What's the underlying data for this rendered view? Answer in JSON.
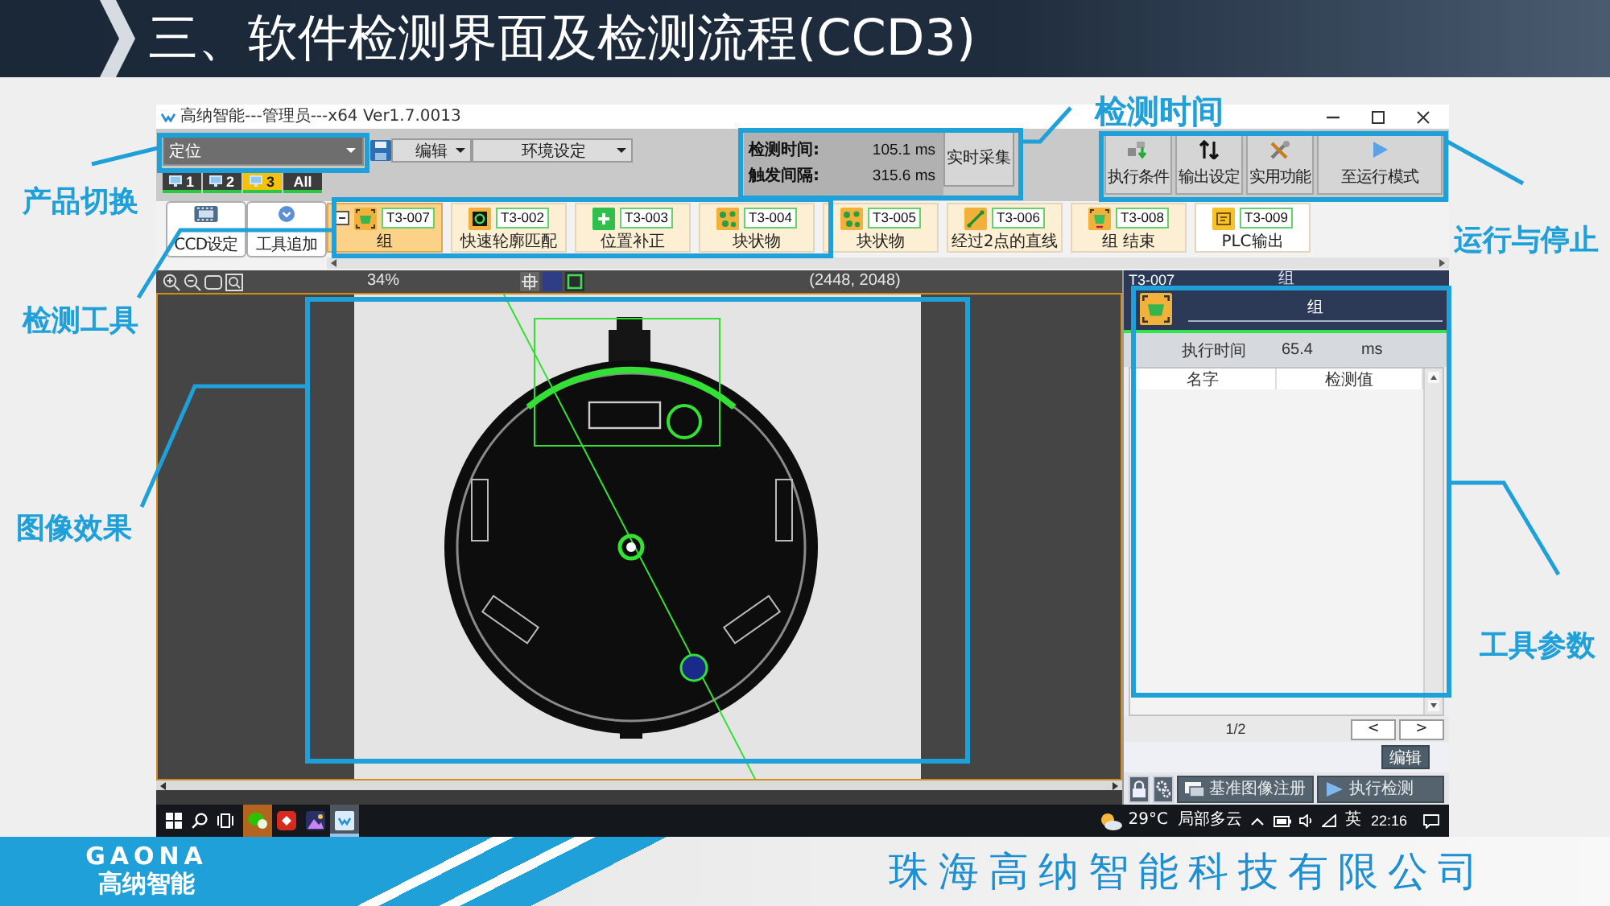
{
  "slide": {
    "title": "三、软件检测界面及检测流程(CCD3)",
    "logo_wordmark": "GAONA",
    "logo_name": "高纳智能",
    "company": "珠海高纳智能科技有限公司"
  },
  "callouts": [
    {
      "label": "检测时间"
    },
    {
      "label": "产品切换"
    },
    {
      "label": "检测工具"
    },
    {
      "label": "运行与停止"
    },
    {
      "label": "图像效果"
    },
    {
      "label": "工具参数"
    }
  ],
  "app": {
    "title": "高纳智能---管理员---x64 Ver1.7.0013",
    "product": {
      "value": "定位"
    },
    "menus": [
      "编辑",
      "环境设定"
    ],
    "cameras": [
      {
        "label": "1",
        "kind": "single",
        "selected": false
      },
      {
        "label": "2",
        "kind": "single",
        "selected": false
      },
      {
        "label": "3",
        "kind": "single",
        "selected": true
      },
      {
        "label": "All",
        "kind": "all",
        "selected": false
      }
    ],
    "timing": [
      {
        "label": "检测时间:",
        "value": "105.1 ms"
      },
      {
        "label": "触发间隔:",
        "value": "315.6 ms"
      }
    ],
    "live_button": "实时采集",
    "mode_buttons": [
      {
        "label": "执行条件",
        "kind": "condition"
      },
      {
        "label": "输出设定",
        "kind": "output"
      },
      {
        "label": "实用功能",
        "kind": "utility"
      },
      {
        "label": "至运行模式",
        "kind": "run"
      }
    ],
    "side_buttons": [
      {
        "label": "CCD设定",
        "kind": "camera"
      },
      {
        "label": "工具追加",
        "kind": "add"
      }
    ],
    "tool_strip": {
      "group_expanded": true,
      "items": [
        {
          "id": "T3-007",
          "label": "组",
          "kind": "group",
          "grouped": true,
          "selected": true
        },
        {
          "id": "T3-002",
          "label": "快速轮廓匹配",
          "kind": "match",
          "grouped": true,
          "selected": false
        },
        {
          "id": "T3-003",
          "label": "位置补正",
          "kind": "position",
          "grouped": true,
          "selected": false
        },
        {
          "id": "T3-004",
          "label": "块状物",
          "kind": "blob",
          "grouped": true,
          "selected": false
        },
        {
          "id": "T3-005",
          "label": "块状物",
          "kind": "blob",
          "grouped": true,
          "selected": false
        },
        {
          "id": "T3-006",
          "label": "经过2点的直线",
          "kind": "line",
          "grouped": true,
          "selected": false
        },
        {
          "id": "T3-008",
          "label": "组 结束",
          "kind": "group-end",
          "grouped": true,
          "selected": false
        },
        {
          "id": "T3-009",
          "label": "PLC输出",
          "kind": "plc",
          "grouped": false,
          "selected": false
        }
      ]
    },
    "viewer": {
      "zoom": "34%",
      "image_size": "(2448, 2048)"
    },
    "detail": {
      "tool_id": "T3-007",
      "tool_type": "组",
      "name": "组",
      "exec_label": "执行时间",
      "exec_value": "65.4",
      "exec_unit": "ms",
      "columns": [
        "名字",
        "检测值"
      ],
      "page": "1/2",
      "prev": "<",
      "next": ">",
      "edit_button": "编辑",
      "actions": [
        {
          "label": "基准图像注册",
          "kind": "register"
        },
        {
          "label": "执行检测",
          "kind": "run"
        }
      ]
    }
  },
  "taskbar": {
    "apps": [
      {
        "kind": "chat",
        "selected": false,
        "attention": true
      },
      {
        "kind": "office",
        "selected": false,
        "attention": false
      },
      {
        "kind": "photos",
        "selected": false,
        "attention": false
      },
      {
        "kind": "inspector",
        "selected": true,
        "attention": false
      }
    ],
    "temperature": "29°C",
    "weather": "局部多云",
    "input_method": "英",
    "time": "22:16"
  }
}
